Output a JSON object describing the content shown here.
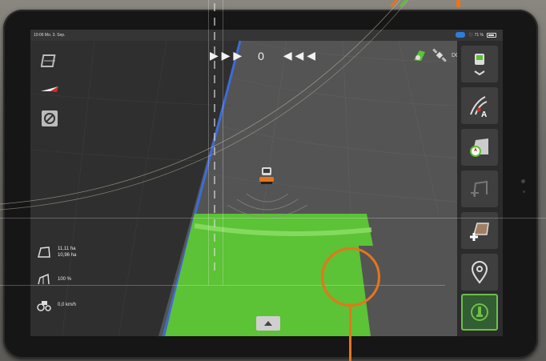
{
  "status_bar": {
    "left": "10:06 Mo. 3. Sep.",
    "pill": "",
    "right": "⚫ 71 %"
  },
  "navigation": {
    "left_arrows": "▶ ▶ ▶",
    "count": "0",
    "right_arrows": "◀ ◀ ◀"
  },
  "gps": {
    "label": "DGPS"
  },
  "stats": [
    {
      "icon": "area-icon",
      "line1": "11,11 ha",
      "line2": "10,96 ha"
    },
    {
      "icon": "overlap-icon",
      "line1": "100 %",
      "line2": ""
    },
    {
      "icon": "tractor-speed-icon",
      "line1": "0,0 km/h",
      "line2": ""
    }
  ],
  "left_tools": [
    {
      "name": "map-layers-icon"
    },
    {
      "name": "compass-icon"
    },
    {
      "name": "zoom-icon"
    }
  ],
  "right_tools": [
    {
      "name": "vehicle-settings-icon",
      "active": false
    },
    {
      "name": "guidance-line-ab-icon",
      "active": false
    },
    {
      "name": "field-boundary-icon",
      "active": false
    },
    {
      "name": "headland-icon",
      "active": false
    },
    {
      "name": "add-field-icon",
      "active": false
    },
    {
      "name": "location-pin-icon",
      "active": false
    },
    {
      "name": "documentation-icon",
      "active": true
    }
  ],
  "colors": {
    "field_green": "#5cc236",
    "ground_dark": "#3a3a3a",
    "ground_light": "#5a5a5a",
    "boundary_blue": "#3d6bd8",
    "accent_orange": "#e8741a",
    "active_green": "#6dc04a"
  }
}
